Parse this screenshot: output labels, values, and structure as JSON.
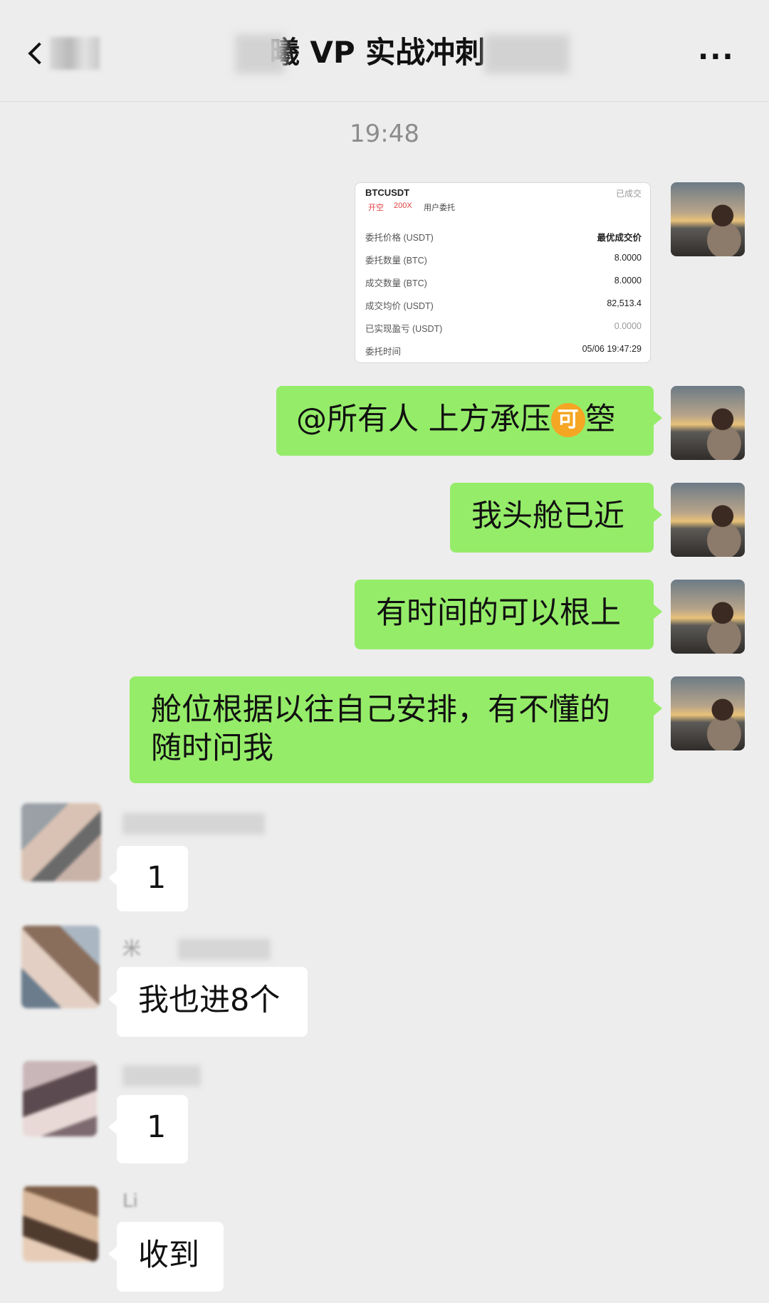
{
  "header": {
    "title": "曦 VP 实战冲刺",
    "back_icon": "chevron-left-icon",
    "more_label": "..."
  },
  "timestamp": "19:48",
  "order_card": {
    "symbol": "BTCUSDT",
    "status": "已成交",
    "tags": [
      "开空",
      "200X",
      "用户委托"
    ],
    "rows": [
      {
        "label": "委托价格 (USDT)",
        "value": "最优成交价"
      },
      {
        "label": "委托数量 (BTC)",
        "value": "8.0000"
      },
      {
        "label": "成交数量 (BTC)",
        "value": "8.0000"
      },
      {
        "label": "成交均价 (USDT)",
        "value": "82,513.4"
      },
      {
        "label": "已实现盈亏 (USDT)",
        "value": "0.0000"
      },
      {
        "label": "委托时间",
        "value": "05/06 19:47:29"
      }
    ]
  },
  "messages_me": [
    {
      "text_a": "@所有人 上方承压",
      "emoji": "可",
      "text_b": "箜"
    },
    {
      "text": "我头舱已近"
    },
    {
      "text": "有时间的可以根上"
    },
    {
      "text": "舱位根据以往自己安排，有不懂的随时问我"
    }
  ],
  "messages_them": [
    {
      "text": "1"
    },
    {
      "name": "米",
      "text": "我也进8个"
    },
    {
      "text": "1"
    },
    {
      "name": "Li",
      "text": "收到"
    }
  ]
}
